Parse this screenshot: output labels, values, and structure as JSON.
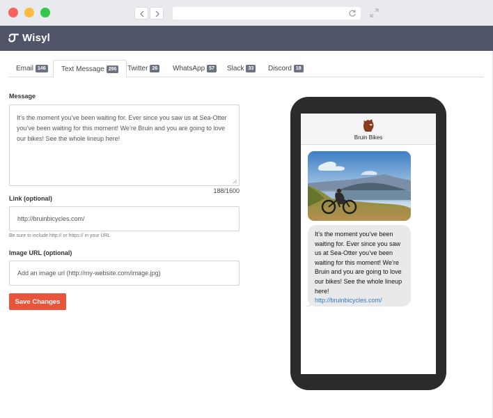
{
  "browser": {
    "address_value": ""
  },
  "app": {
    "name": "Wisyl"
  },
  "tabs": [
    {
      "label": "Email",
      "count": "146"
    },
    {
      "label": "Text Message",
      "count": "296"
    },
    {
      "label": "Twitter",
      "count": "26"
    },
    {
      "label": "WhatsApp",
      "count": "57"
    },
    {
      "label": "Slack",
      "count": "33"
    },
    {
      "label": "Discord",
      "count": "18"
    }
  ],
  "form": {
    "message_label": "Message",
    "message_value": "It’s the moment you’ve been waiting for. Ever since you saw us at Sea-Otter you’ve been waiting for this moment! We’re Bruin and you are going to love our bikes! See the whole lineup here!",
    "char_counter": "188/1600",
    "link_label": "Link (optional)",
    "link_value": "http://bruinbicycles.com/",
    "link_help": "Be sure to include http:// or https:// in your URL",
    "image_label": "Image URL (optional)",
    "image_placeholder": "Add an image url (http://my-website.com/image.jpg)",
    "save_label": "Save Changes"
  },
  "preview": {
    "contact_name": "Bruin Bikes",
    "message_text": "It’s the moment you’ve been waiting for. Ever since you saw us at Sea-Otter you’ve been waiting for this moment! We’re Bruin and you are going to love our bikes! See the whole lineup here!",
    "message_link": "http://bruinbicycles.com/"
  },
  "icons": {
    "logo": "wisyl-logo-icon",
    "back": "chevron-left-icon",
    "forward": "chevron-right-icon",
    "reload": "reload-icon",
    "expand": "expand-icon",
    "contact": "bear-icon"
  },
  "colors": {
    "header_bg": "#4f5468",
    "accent": "#e9543a",
    "badge": "#6d7283",
    "link": "#2f7ac6"
  }
}
